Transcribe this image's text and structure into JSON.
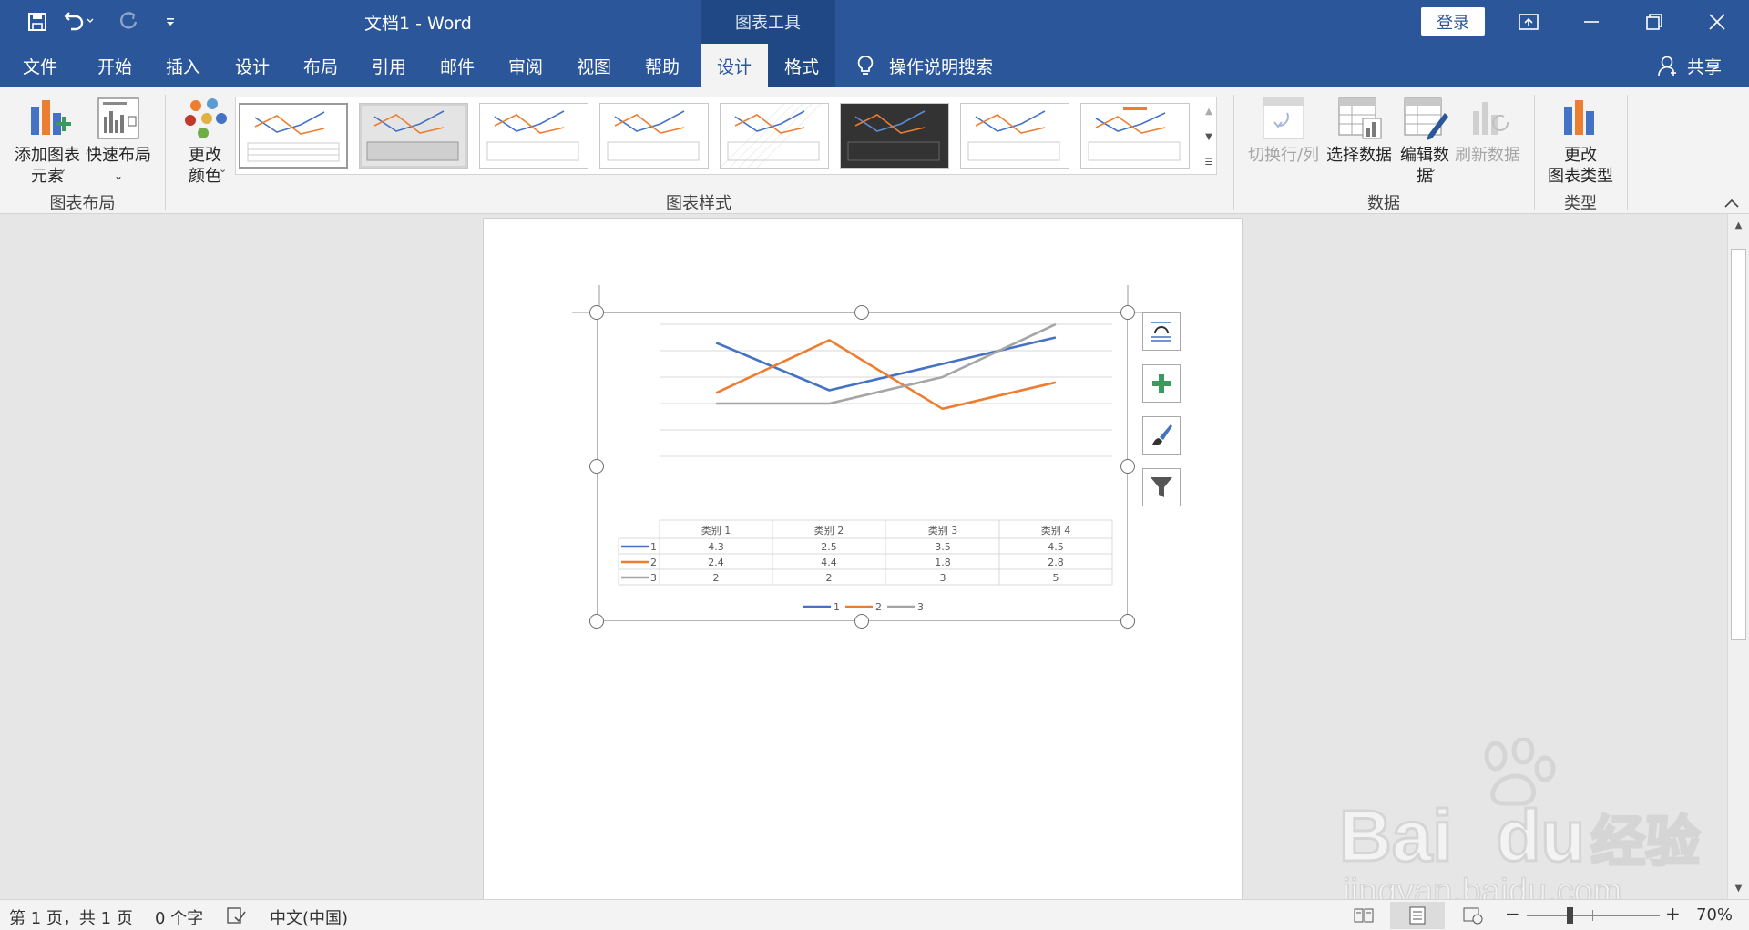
{
  "window": {
    "title": "文档1  -  Word",
    "context_tab": "图表工具",
    "login": "登录"
  },
  "tabs": [
    {
      "label": "文件"
    },
    {
      "label": "开始"
    },
    {
      "label": "插入"
    },
    {
      "label": "设计"
    },
    {
      "label": "布局"
    },
    {
      "label": "引用"
    },
    {
      "label": "邮件"
    },
    {
      "label": "审阅"
    },
    {
      "label": "视图"
    },
    {
      "label": "帮助"
    },
    {
      "label": "设计"
    },
    {
      "label": "格式"
    }
  ],
  "search": {
    "label": "操作说明搜索"
  },
  "share": {
    "label": "共享"
  },
  "ribbon": {
    "add_element": {
      "line1": "添加图表",
      "line2": "元素"
    },
    "quick_layout": {
      "line1": "快速布局"
    },
    "change_color": {
      "line1": "更改",
      "line2": "颜色"
    },
    "group_layout": "图表布局",
    "group_styles": "图表样式",
    "switch_row_col": "切换行/列",
    "select_data": "选择数据",
    "edit_data": {
      "line1": "编辑数",
      "line2": "据"
    },
    "refresh_data": "刷新数据",
    "group_data": "数据",
    "change_type": {
      "line1": "更改",
      "line2": "图表类型"
    },
    "group_type": "类型"
  },
  "colors": {
    "accent": "#2b579a",
    "series1": "#4472c4",
    "series2": "#ed7d31",
    "series3": "#a5a5a5"
  },
  "chart_data": {
    "type": "line",
    "categories": [
      "类别 1",
      "类别 2",
      "类别 3",
      "类别 4"
    ],
    "series": [
      {
        "name": "1",
        "values": [
          4.3,
          2.5,
          3.5,
          4.5
        ]
      },
      {
        "name": "2",
        "values": [
          2.4,
          4.4,
          1.8,
          2.8
        ]
      },
      {
        "name": "3",
        "values": [
          2,
          2,
          3,
          5
        ]
      }
    ],
    "ylim": [
      0,
      5
    ],
    "grid": true,
    "legend": "bottom",
    "data_table": true,
    "table_values": [
      [
        "4.3",
        "2.5",
        "3.5",
        "4.5"
      ],
      [
        "2.4",
        "4.4",
        "1.8",
        "2.8"
      ],
      [
        "2",
        "2",
        "3",
        "5"
      ]
    ]
  },
  "status": {
    "page": "第 1 页，共 1 页",
    "words": "0 个字",
    "lang": "中文(中国)",
    "zoom": "70%"
  },
  "watermark": {
    "brand": "Bai",
    "brand2": "du",
    "cn": "经验",
    "url": "jingyan.baidu.com"
  }
}
